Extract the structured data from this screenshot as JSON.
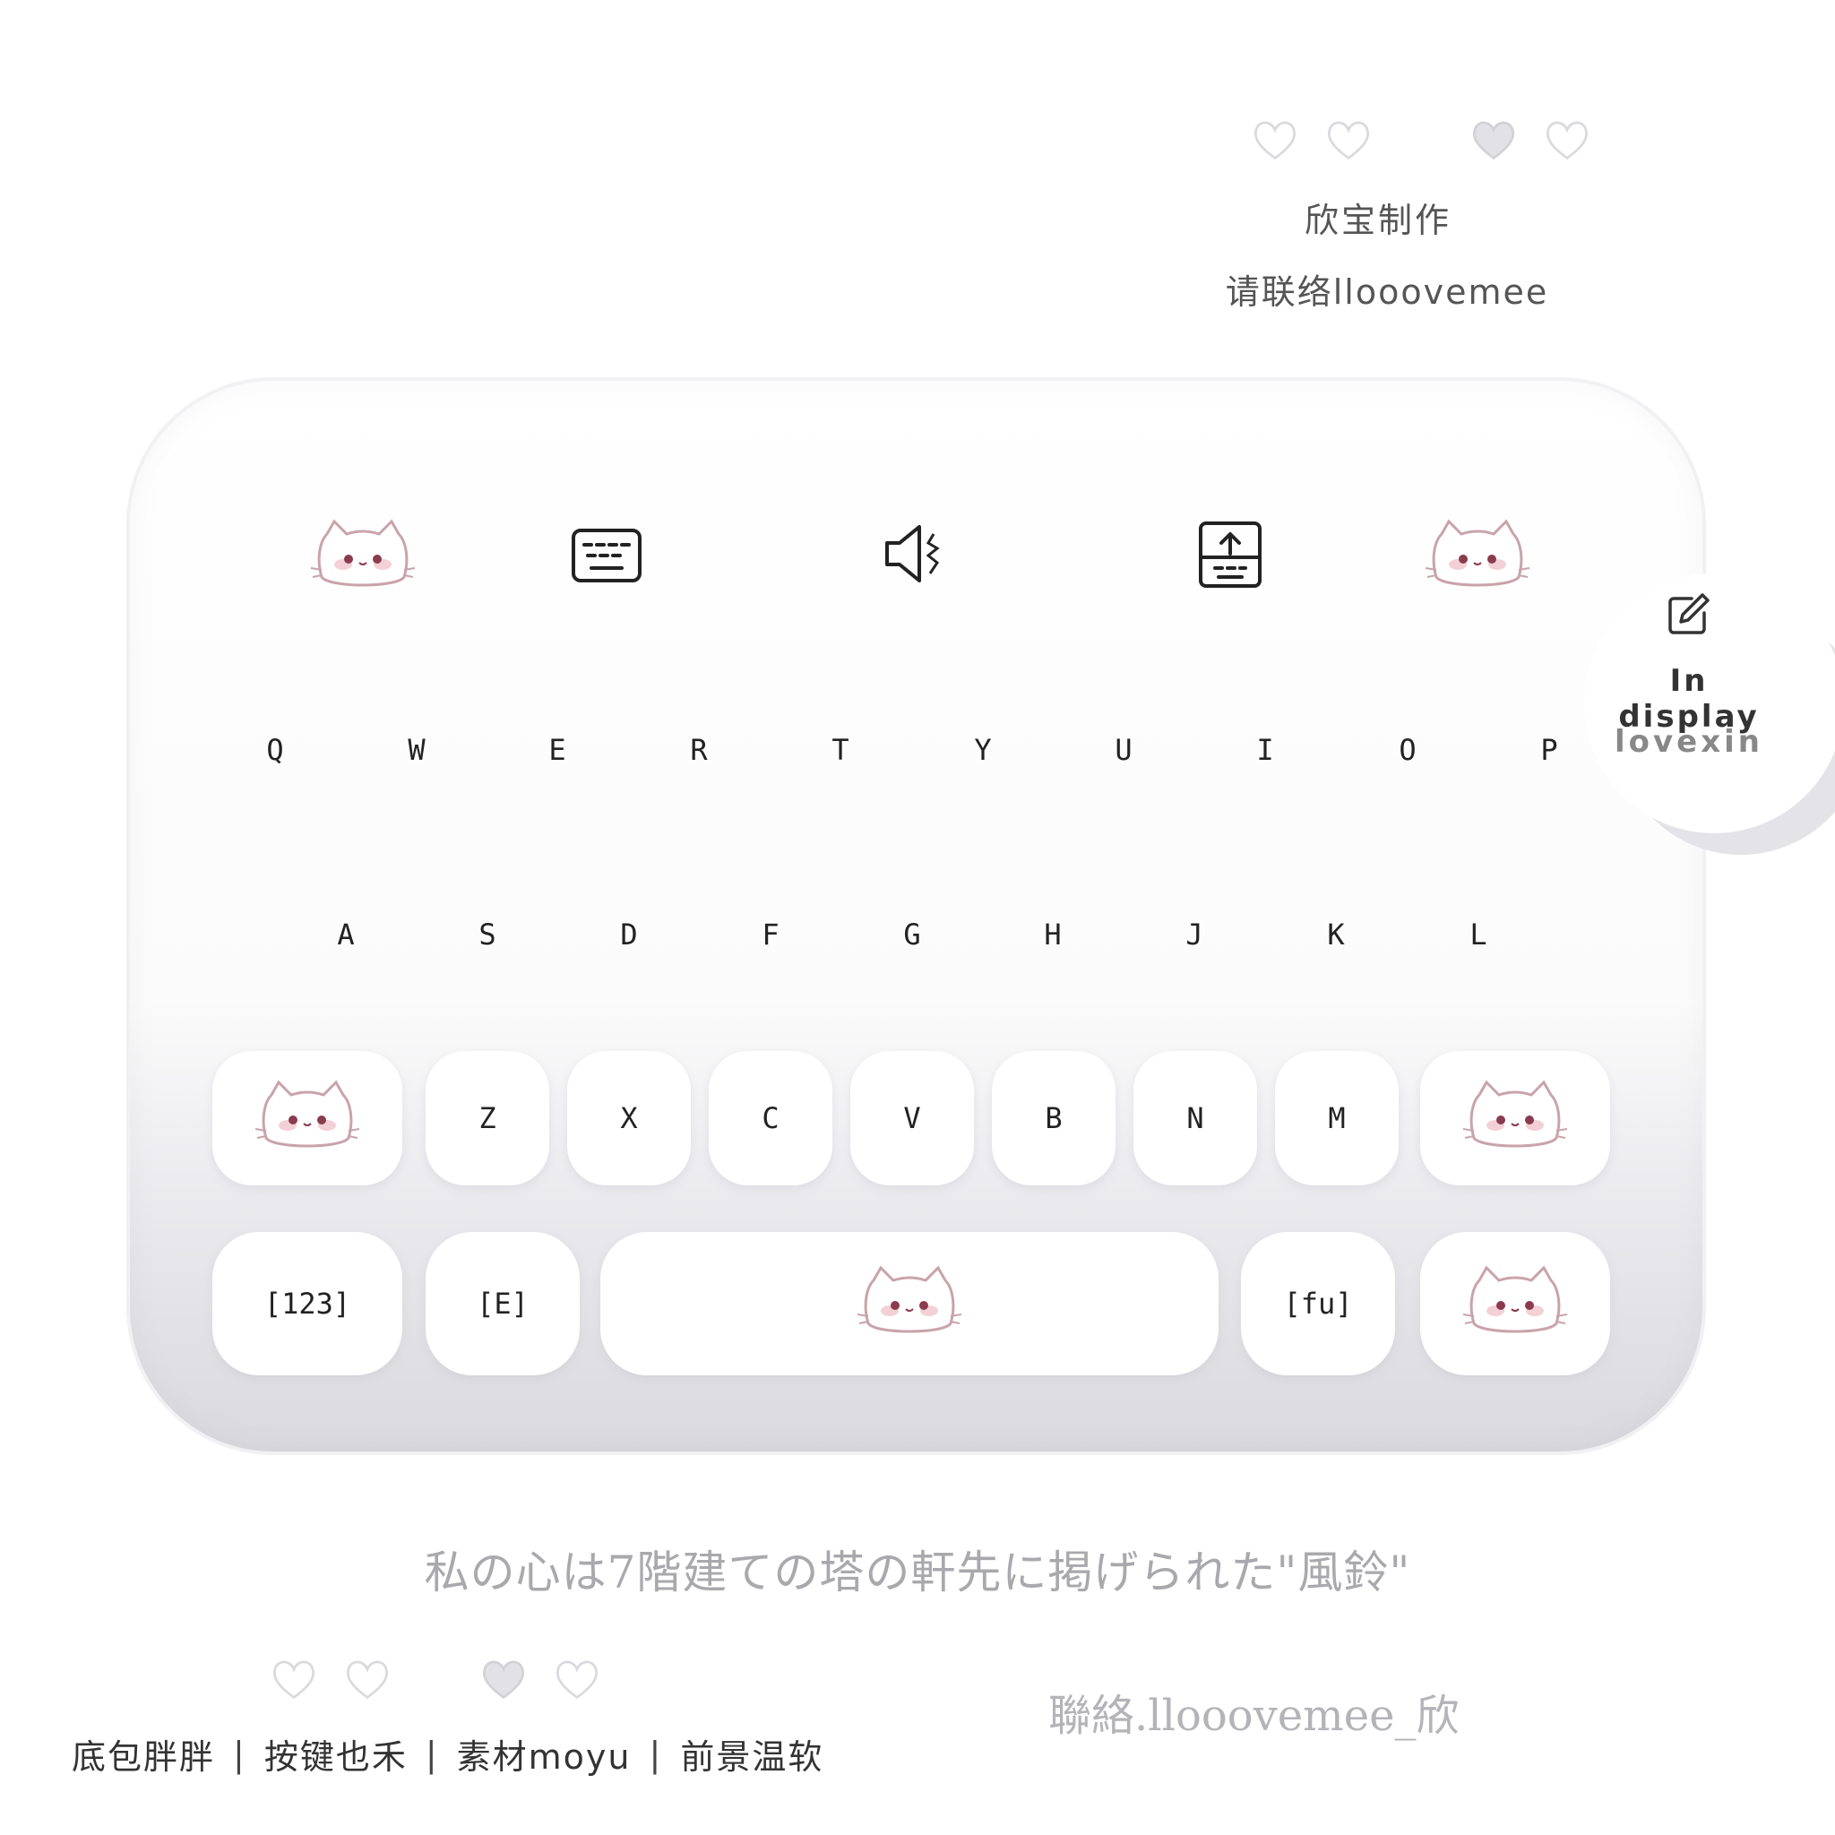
{
  "header": {
    "credit_line_1": "欣宝制作",
    "credit_line_2": "请联络llooovemee"
  },
  "toolbar": {
    "items": [
      "cat-icon",
      "keyboard-icon",
      "speaker-icon",
      "upload-icon",
      "cat-icon"
    ]
  },
  "keyboard": {
    "row1": [
      "Q",
      "W",
      "E",
      "R",
      "T",
      "Y",
      "U",
      "I",
      "O",
      "P"
    ],
    "row2": [
      "A",
      "S",
      "D",
      "F",
      "G",
      "H",
      "J",
      "K",
      "L"
    ],
    "row3": [
      "Z",
      "X",
      "C",
      "V",
      "B",
      "N",
      "M"
    ],
    "bottom": {
      "num_label": "[123]",
      "lang_label": "[E]",
      "sym_label": "[fu]"
    }
  },
  "side_panel": {
    "title": "In display",
    "subtitle": "lovexin"
  },
  "quote": "私の心は7階建ての塔の軒先に掲げられた\"風鈴\"",
  "contact": "聯絡.llooovemee_欣",
  "footer": {
    "items": [
      "底包胖胖",
      "按键也禾",
      "素材moyu",
      "前景温软"
    ],
    "separator": "|"
  },
  "colors": {
    "accent_blush": "#e8b7c1",
    "cat_outline": "#c9a3ab",
    "key_bg": "#ffffff",
    "panel_gradient_bottom": "#d9d9de"
  }
}
